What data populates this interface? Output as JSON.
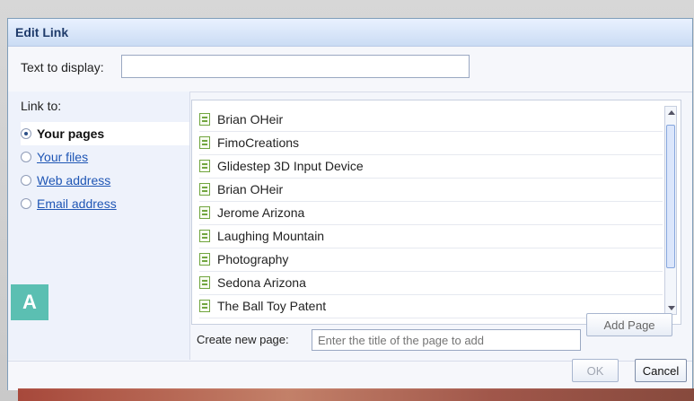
{
  "dialog": {
    "title": "Edit Link"
  },
  "text_to_display": {
    "label": "Text to display:",
    "value": ""
  },
  "link_to": {
    "label": "Link to:",
    "options": [
      {
        "label": "Your pages",
        "selected": true
      },
      {
        "label": "Your files",
        "selected": false
      },
      {
        "label": "Web address",
        "selected": false
      },
      {
        "label": "Email address",
        "selected": false
      }
    ]
  },
  "pages": [
    "Brian OHeir",
    "FimoCreations",
    "Glidestep 3D Input Device",
    "Brian OHeir",
    "Jerome Arizona",
    "Laughing Mountain",
    "Photography",
    "Sedona Arizona",
    "The Ball Toy Patent"
  ],
  "create_new_page": {
    "label": "Create new page:",
    "placeholder": "Enter the title of the page to add",
    "button": "Add Page"
  },
  "buttons": {
    "ok": "OK",
    "cancel": "Cancel"
  },
  "badge": {
    "label": "A"
  }
}
